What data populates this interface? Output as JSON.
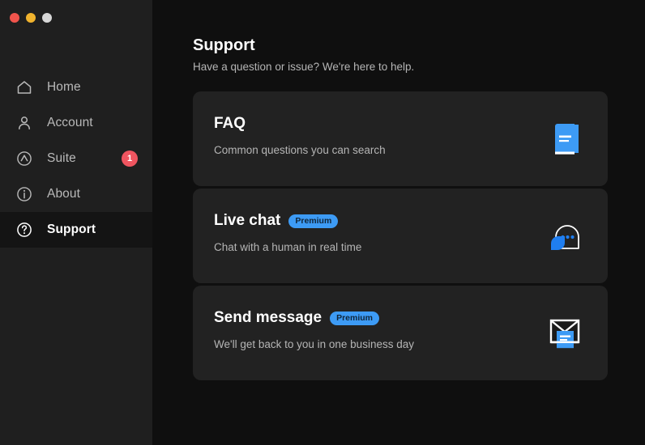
{
  "window": {
    "traffic_lights": [
      {
        "name": "close",
        "color": "#f0544c"
      },
      {
        "name": "minimize",
        "color": "#f0b32e"
      },
      {
        "name": "zoom",
        "color": "#d7d7d7"
      }
    ]
  },
  "sidebar": {
    "items": [
      {
        "label": "Home",
        "icon": "home-icon",
        "active": false,
        "badge": null
      },
      {
        "label": "Account",
        "icon": "person-icon",
        "active": false,
        "badge": null
      },
      {
        "label": "Suite",
        "icon": "suite-icon",
        "active": false,
        "badge": "1"
      },
      {
        "label": "About",
        "icon": "info-icon",
        "active": false,
        "badge": null
      },
      {
        "label": "Support",
        "icon": "help-icon",
        "active": true,
        "badge": null
      }
    ],
    "badge_color": "#f05560",
    "active_bg": "#141414",
    "background": "#1f1f1f"
  },
  "main": {
    "title": "Support",
    "subtitle": "Have a question or issue? We're here to help.",
    "background": "#0f0f0f",
    "accent": "#3d9bf5",
    "cards": [
      {
        "title": "FAQ",
        "badge": null,
        "desc": "Common questions you can search",
        "icon": "book-icon"
      },
      {
        "title": "Live chat",
        "badge": "Premium",
        "desc": "Chat with a human in real time",
        "icon": "chat-bubbles-icon"
      },
      {
        "title": "Send message",
        "badge": "Premium",
        "desc": "We'll get back to you in one business day",
        "icon": "envelope-icon"
      }
    ]
  }
}
